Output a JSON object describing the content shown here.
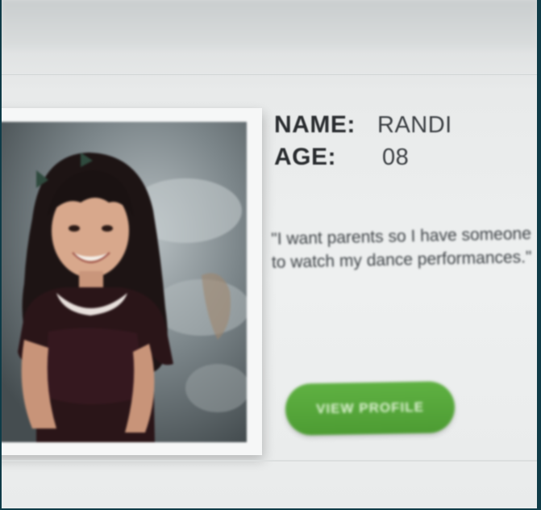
{
  "profile": {
    "name_label": "NAME:",
    "name_value": "RANDI",
    "age_label": "AGE:",
    "age_value": "08",
    "quote": "\"I want parents so I have someone to watch my dance performances.\"",
    "button_label": "VIEW PROFILE"
  },
  "colors": {
    "button_green": "#4f9f35",
    "text_dark": "#2a2d30",
    "page_bg": "#eceeee"
  }
}
